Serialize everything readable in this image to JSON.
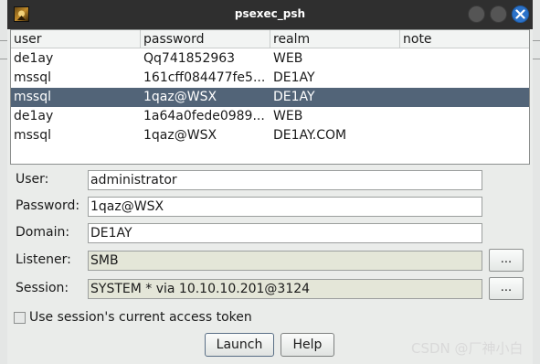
{
  "window": {
    "title": "psexec_psh",
    "icon": "app-icon"
  },
  "table": {
    "columns": [
      "user",
      "password",
      "realm",
      "note"
    ],
    "rows": [
      {
        "user": "de1ay",
        "password": "Qq741852963",
        "realm": "WEB",
        "note": ""
      },
      {
        "user": "mssql",
        "password": "161cff084477fe5...",
        "realm": "DE1AY",
        "note": ""
      },
      {
        "user": "mssql",
        "password": "1qaz@WSX",
        "realm": "DE1AY",
        "note": "",
        "selected": true
      },
      {
        "user": "de1ay",
        "password": "1a64a0fede0989...",
        "realm": "WEB",
        "note": ""
      },
      {
        "user": "mssql",
        "password": "1qaz@WSX",
        "realm": "DE1AY.COM",
        "note": ""
      }
    ],
    "selection_color": "#526478"
  },
  "form": {
    "user_label": "User:",
    "user_value": "administrator",
    "password_label": "Password:",
    "password_value": "1qaz@WSX",
    "domain_label": "Domain:",
    "domain_value": "DE1AY",
    "listener_label": "Listener:",
    "listener_value": "SMB",
    "session_label": "Session:",
    "session_value": "SYSTEM * via  10.10.10.201@3124",
    "browse_label": "...",
    "token_label": "Use session's current access token",
    "token_checked": false
  },
  "buttons": {
    "launch": "Launch",
    "help": "Help"
  },
  "watermark": "CSDN @厂神小白"
}
